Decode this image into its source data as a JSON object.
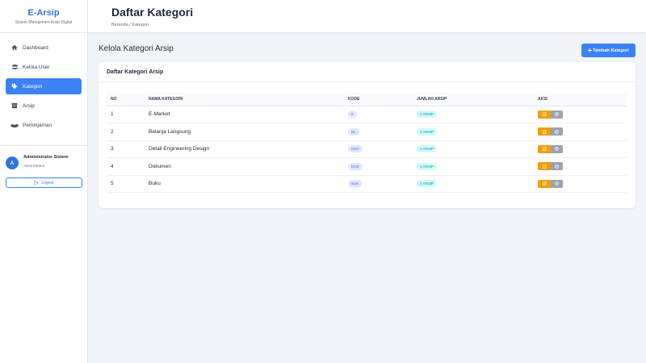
{
  "sidebar": {
    "brand_title": "E-Arsip",
    "brand_sub": "Sistem Manajemen Arsip Digital",
    "items": [
      {
        "label": "Dashboard",
        "icon": "home-icon"
      },
      {
        "label": "Kelola User",
        "icon": "users-icon"
      },
      {
        "label": "Kategori",
        "icon": "tag-icon",
        "active": true
      },
      {
        "label": "Arsip",
        "icon": "archive-icon"
      },
      {
        "label": "Peminjaman",
        "icon": "handshake-icon"
      }
    ],
    "user_name": "Administrator Sistem",
    "user_role": "Administrator",
    "avatar_initial": "A",
    "logout_label": "Logout"
  },
  "header": {
    "title": "Daftar Kategori",
    "breadcrumb": "Beranda / Kategori"
  },
  "main": {
    "section_title": "Kelola Kategori Arsip",
    "add_button": "Tambah Kategori",
    "card_title": "Daftar Kategori Arsip",
    "columns": [
      "NO",
      "NAMA KATEGORI",
      "KODE",
      "JUMLAH ARSIP",
      "AKSI"
    ],
    "rows": [
      {
        "no": "1",
        "nama": "E-Market",
        "kode": "E",
        "jumlah": "2 ARSIP"
      },
      {
        "no": "2",
        "nama": "Belanja Langsung",
        "kode": "BL",
        "jumlah": "2 ARSIP"
      },
      {
        "no": "3",
        "nama": "Detail Engineering Design",
        "kode": "DED",
        "jumlah": "2 ARSIP"
      },
      {
        "no": "4",
        "nama": "Dokumen",
        "kode": "DOK",
        "jumlah": "1 ARSIP"
      },
      {
        "no": "5",
        "nama": "Buku",
        "kode": "BUK",
        "jumlah": "1 ARSIP"
      }
    ]
  },
  "colors": {
    "primary": "#3b82f6",
    "brand": "#2f74e0",
    "edit": "#f59e0b",
    "delete": "#9ca3af"
  }
}
